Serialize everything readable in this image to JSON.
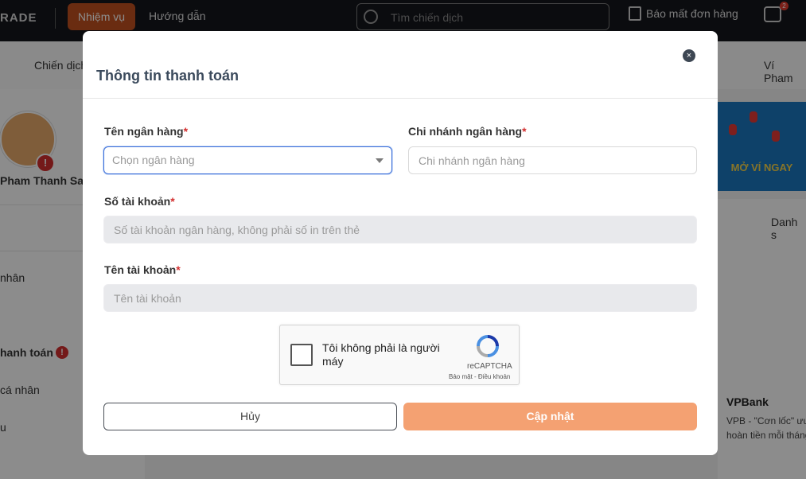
{
  "topbar": {
    "logo": "RADE",
    "nav_active": "Nhiệm vụ",
    "nav_link": "Hướng dẫn",
    "search_placeholder": "Tìm chiến dịch",
    "report_label": "Báo mất đơn hàng",
    "cart_badge": "2"
  },
  "subnav": {
    "left_tab": "Chiến dịch",
    "right_tab": "Ví Pham"
  },
  "sidebar": {
    "user_name": "Pham Thanh Sa",
    "alert_glyph": "!",
    "items": [
      "nhân",
      "hanh toán",
      "cá nhân",
      "u"
    ]
  },
  "banner": {
    "cta": "MỞ VÍ NGAY"
  },
  "right_panel": {
    "tab": "Danh s",
    "bank_name": "VPBank",
    "desc_line1": "VPB - \"Cơn lốc\" ưu",
    "desc_line2": "hoàn tiền mỗi tháng"
  },
  "modal": {
    "title": "Thông tin thanh toán",
    "close_glyph": "×",
    "bank": {
      "label": "Tên ngân hàng",
      "placeholder": "Chọn ngân hàng"
    },
    "branch": {
      "label": "Chi nhánh ngân hàng",
      "placeholder": "Chi nhánh ngân hàng"
    },
    "account_no": {
      "label": "Số tài khoản",
      "placeholder": "Số tài khoản ngân hàng, không phải số in trên thẻ"
    },
    "account_name": {
      "label": "Tên tài khoản",
      "placeholder": "Tên tài khoản"
    },
    "required_mark": "*",
    "captcha": {
      "text": "Tôi không phải là người máy",
      "brand": "reCAPTCHA",
      "links": "Bảo mật - Điều khoản"
    },
    "cancel_label": "Hủy",
    "update_label": "Cập nhật"
  },
  "colors": {
    "accent_orange": "#f4a172",
    "nav_active": "#c2511f",
    "focus_blue": "#3b6fd9",
    "required_red": "#d32f2f"
  }
}
